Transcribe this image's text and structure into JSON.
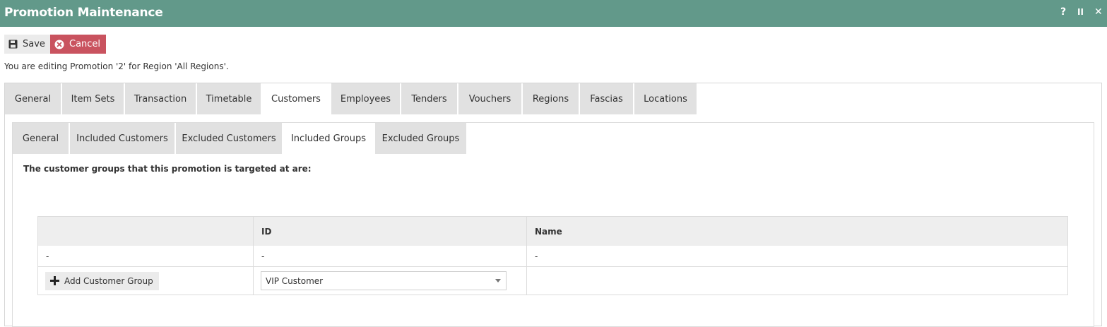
{
  "window": {
    "title": "Promotion Maintenance",
    "help_glyph": "?",
    "pause_glyph": "II",
    "close_glyph": "✕"
  },
  "toolbar": {
    "save_label": "Save",
    "cancel_label": "Cancel"
  },
  "edit_info": "You are editing Promotion '2' for Region 'All Regions'.",
  "outer_tabs": [
    {
      "label": "General"
    },
    {
      "label": "Item Sets"
    },
    {
      "label": "Transaction"
    },
    {
      "label": "Timetable"
    },
    {
      "label": "Customers",
      "active": true
    },
    {
      "label": "Employees"
    },
    {
      "label": "Tenders"
    },
    {
      "label": "Vouchers"
    },
    {
      "label": "Regions"
    },
    {
      "label": "Fascias"
    },
    {
      "label": "Locations"
    }
  ],
  "inner_tabs": [
    {
      "label": "General"
    },
    {
      "label": "Included Customers"
    },
    {
      "label": "Excluded Customers"
    },
    {
      "label": "Included Groups",
      "active": true
    },
    {
      "label": "Excluded Groups"
    }
  ],
  "section_heading": "The customer groups that this promotion is targeted at are:",
  "grid": {
    "columns": [
      "",
      "ID",
      "Name"
    ],
    "rows": [
      [
        "-",
        "-",
        "-"
      ]
    ],
    "add_button_label": "Add Customer Group",
    "selected_group": "VIP Customer"
  },
  "colors": {
    "titlebar": "#62998a",
    "cancel": "#c9535f",
    "tab_inactive": "#e1e1e1",
    "grid_header": "#eeeeee"
  }
}
